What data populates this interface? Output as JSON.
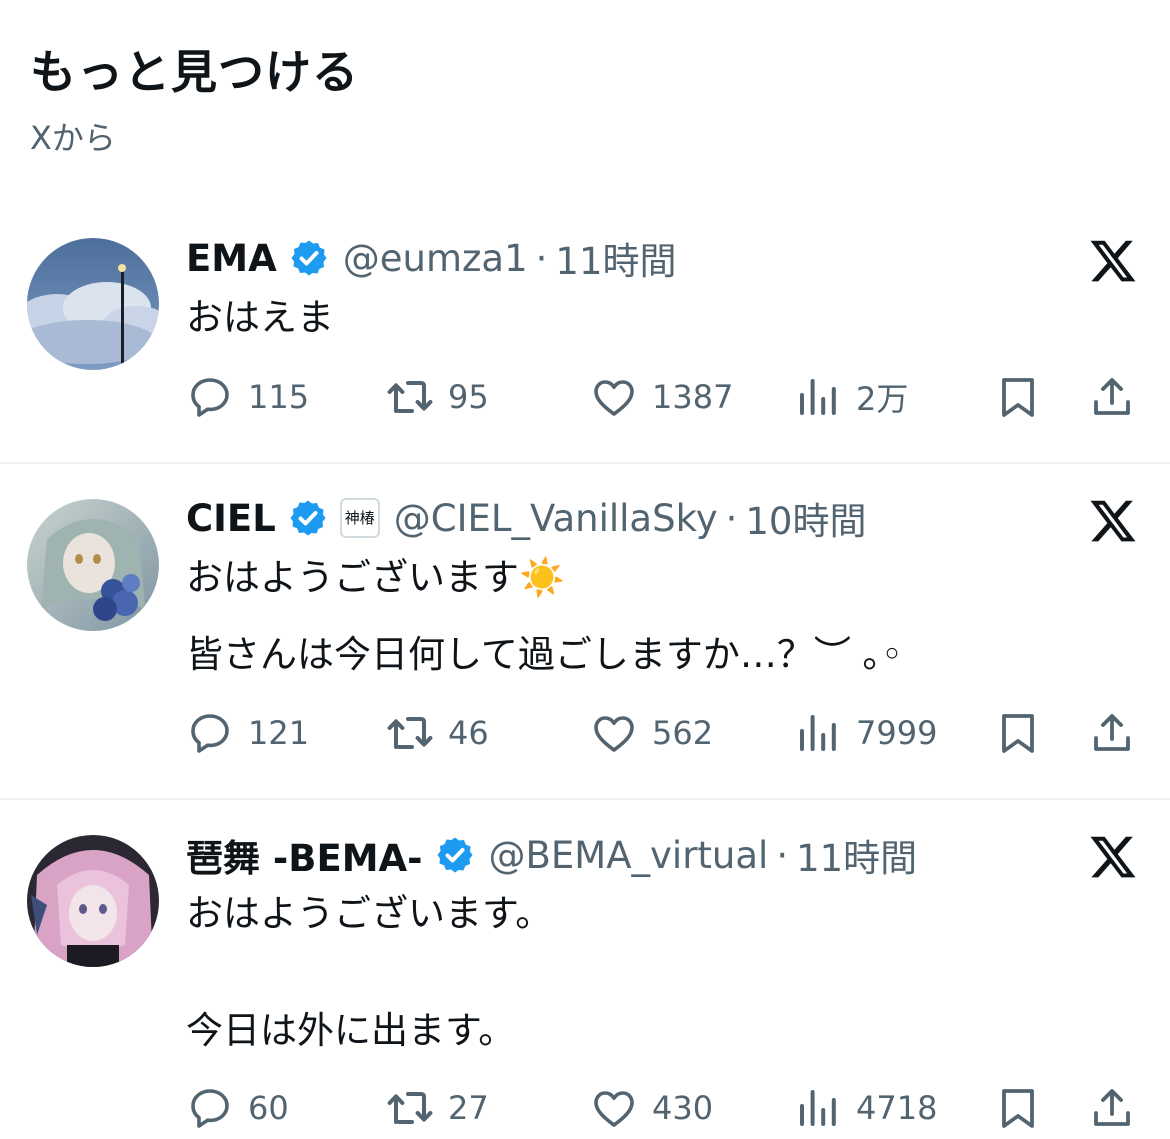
{
  "header": {
    "title": "もっと見つける",
    "subtitle": "Xから"
  },
  "posts": [
    {
      "name": "EMA",
      "handle": "@eumza1",
      "separator": "·",
      "time": "11時間",
      "text": [
        "おはえま"
      ],
      "replies": "115",
      "reposts": "95",
      "likes": "1387",
      "views": "2万"
    },
    {
      "name": "CIEL",
      "affiliate_badge": "神椿",
      "handle": "@CIEL_VanillaSky",
      "separator": "·",
      "time": "10時間",
      "text": [
        "おはようございます☀️",
        "皆さんは今日何して過ごしますか…？︶ ｡◦"
      ],
      "replies": "121",
      "reposts": "46",
      "likes": "562",
      "views": "7999"
    },
    {
      "name": "琶舞 -BEMA-",
      "handle": "@BEMA_virtual",
      "separator": "·",
      "time": "11時間",
      "text": [
        "おはようございます。",
        "",
        "今日は外に出ます。"
      ],
      "replies": "60",
      "reposts": "27",
      "likes": "430",
      "views": "4718"
    }
  ],
  "colors": {
    "text": "#0f1419",
    "secondary": "#536471",
    "verified": "#1d9bf0",
    "divider": "#eff3f4"
  },
  "icons": [
    "reply-icon",
    "repost-icon",
    "like-icon",
    "views-icon",
    "bookmark-icon",
    "share-icon",
    "x-logo-icon",
    "verified-badge-icon"
  ]
}
